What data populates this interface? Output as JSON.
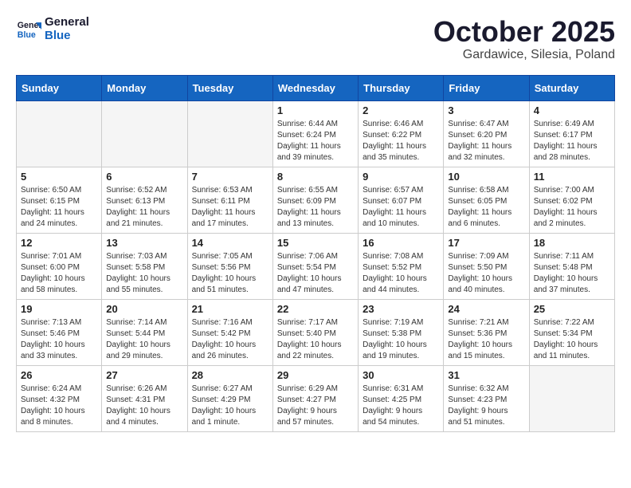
{
  "header": {
    "logo_line1": "General",
    "logo_line2": "Blue",
    "month": "October 2025",
    "location": "Gardawice, Silesia, Poland"
  },
  "weekdays": [
    "Sunday",
    "Monday",
    "Tuesday",
    "Wednesday",
    "Thursday",
    "Friday",
    "Saturday"
  ],
  "weeks": [
    [
      {
        "day": "",
        "info": ""
      },
      {
        "day": "",
        "info": ""
      },
      {
        "day": "",
        "info": ""
      },
      {
        "day": "1",
        "info": "Sunrise: 6:44 AM\nSunset: 6:24 PM\nDaylight: 11 hours\nand 39 minutes."
      },
      {
        "day": "2",
        "info": "Sunrise: 6:46 AM\nSunset: 6:22 PM\nDaylight: 11 hours\nand 35 minutes."
      },
      {
        "day": "3",
        "info": "Sunrise: 6:47 AM\nSunset: 6:20 PM\nDaylight: 11 hours\nand 32 minutes."
      },
      {
        "day": "4",
        "info": "Sunrise: 6:49 AM\nSunset: 6:17 PM\nDaylight: 11 hours\nand 28 minutes."
      }
    ],
    [
      {
        "day": "5",
        "info": "Sunrise: 6:50 AM\nSunset: 6:15 PM\nDaylight: 11 hours\nand 24 minutes."
      },
      {
        "day": "6",
        "info": "Sunrise: 6:52 AM\nSunset: 6:13 PM\nDaylight: 11 hours\nand 21 minutes."
      },
      {
        "day": "7",
        "info": "Sunrise: 6:53 AM\nSunset: 6:11 PM\nDaylight: 11 hours\nand 17 minutes."
      },
      {
        "day": "8",
        "info": "Sunrise: 6:55 AM\nSunset: 6:09 PM\nDaylight: 11 hours\nand 13 minutes."
      },
      {
        "day": "9",
        "info": "Sunrise: 6:57 AM\nSunset: 6:07 PM\nDaylight: 11 hours\nand 10 minutes."
      },
      {
        "day": "10",
        "info": "Sunrise: 6:58 AM\nSunset: 6:05 PM\nDaylight: 11 hours\nand 6 minutes."
      },
      {
        "day": "11",
        "info": "Sunrise: 7:00 AM\nSunset: 6:02 PM\nDaylight: 11 hours\nand 2 minutes."
      }
    ],
    [
      {
        "day": "12",
        "info": "Sunrise: 7:01 AM\nSunset: 6:00 PM\nDaylight: 10 hours\nand 58 minutes."
      },
      {
        "day": "13",
        "info": "Sunrise: 7:03 AM\nSunset: 5:58 PM\nDaylight: 10 hours\nand 55 minutes."
      },
      {
        "day": "14",
        "info": "Sunrise: 7:05 AM\nSunset: 5:56 PM\nDaylight: 10 hours\nand 51 minutes."
      },
      {
        "day": "15",
        "info": "Sunrise: 7:06 AM\nSunset: 5:54 PM\nDaylight: 10 hours\nand 47 minutes."
      },
      {
        "day": "16",
        "info": "Sunrise: 7:08 AM\nSunset: 5:52 PM\nDaylight: 10 hours\nand 44 minutes."
      },
      {
        "day": "17",
        "info": "Sunrise: 7:09 AM\nSunset: 5:50 PM\nDaylight: 10 hours\nand 40 minutes."
      },
      {
        "day": "18",
        "info": "Sunrise: 7:11 AM\nSunset: 5:48 PM\nDaylight: 10 hours\nand 37 minutes."
      }
    ],
    [
      {
        "day": "19",
        "info": "Sunrise: 7:13 AM\nSunset: 5:46 PM\nDaylight: 10 hours\nand 33 minutes."
      },
      {
        "day": "20",
        "info": "Sunrise: 7:14 AM\nSunset: 5:44 PM\nDaylight: 10 hours\nand 29 minutes."
      },
      {
        "day": "21",
        "info": "Sunrise: 7:16 AM\nSunset: 5:42 PM\nDaylight: 10 hours\nand 26 minutes."
      },
      {
        "day": "22",
        "info": "Sunrise: 7:17 AM\nSunset: 5:40 PM\nDaylight: 10 hours\nand 22 minutes."
      },
      {
        "day": "23",
        "info": "Sunrise: 7:19 AM\nSunset: 5:38 PM\nDaylight: 10 hours\nand 19 minutes."
      },
      {
        "day": "24",
        "info": "Sunrise: 7:21 AM\nSunset: 5:36 PM\nDaylight: 10 hours\nand 15 minutes."
      },
      {
        "day": "25",
        "info": "Sunrise: 7:22 AM\nSunset: 5:34 PM\nDaylight: 10 hours\nand 11 minutes."
      }
    ],
    [
      {
        "day": "26",
        "info": "Sunrise: 6:24 AM\nSunset: 4:32 PM\nDaylight: 10 hours\nand 8 minutes."
      },
      {
        "day": "27",
        "info": "Sunrise: 6:26 AM\nSunset: 4:31 PM\nDaylight: 10 hours\nand 4 minutes."
      },
      {
        "day": "28",
        "info": "Sunrise: 6:27 AM\nSunset: 4:29 PM\nDaylight: 10 hours\nand 1 minute."
      },
      {
        "day": "29",
        "info": "Sunrise: 6:29 AM\nSunset: 4:27 PM\nDaylight: 9 hours\nand 57 minutes."
      },
      {
        "day": "30",
        "info": "Sunrise: 6:31 AM\nSunset: 4:25 PM\nDaylight: 9 hours\nand 54 minutes."
      },
      {
        "day": "31",
        "info": "Sunrise: 6:32 AM\nSunset: 4:23 PM\nDaylight: 9 hours\nand 51 minutes."
      },
      {
        "day": "",
        "info": ""
      }
    ]
  ]
}
